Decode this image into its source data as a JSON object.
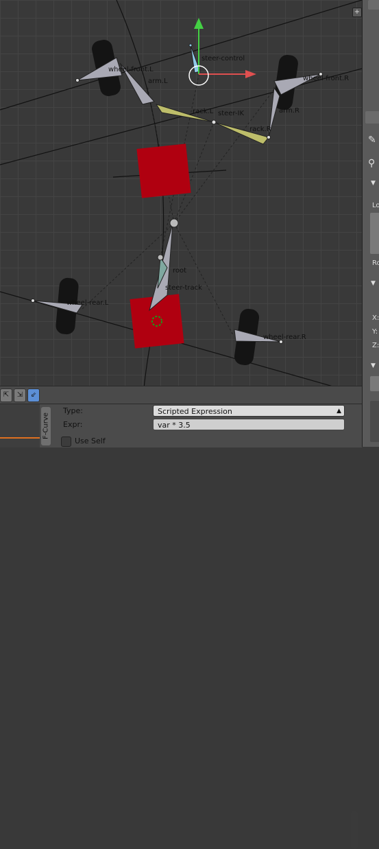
{
  "viewport": {
    "bones": {
      "steer_control": "steer-control",
      "wheel_front_l": "wheel-front.L",
      "wheel_front_r": "wheel-front.R",
      "arm_l": "arm.L",
      "arm_r": "arm.R",
      "rack_l": "rack.L",
      "rack_r": "rack.R",
      "steer_ik": "steer-IK",
      "root": "root",
      "steer_track": "steer-track",
      "wheel_rear_l": "wheel-rear.L",
      "wheel_rear_r": "wheel-rear.R"
    },
    "colors": {
      "bone": "#a9a9b4",
      "bone_selected": "#bdbd6a",
      "marker": "#b00010",
      "wheel": "#141414",
      "axis_y": "#44d044",
      "axis_x": "#e05050"
    }
  },
  "right_panel": {
    "labels": [
      "Lo",
      "Ro",
      "X:",
      "Y:",
      "Z:"
    ]
  },
  "header": {
    "icons": [
      "snap-target-icon",
      "snap-node-icon",
      "snap-pivot-icon"
    ]
  },
  "fcurve_panel": {
    "tab_label": "F-Curve",
    "type_label": "Type:",
    "type_value": "Scripted Expression",
    "expr_label": "Expr:",
    "expr_value": "var * 3.5",
    "use_self_label": "Use Self"
  }
}
